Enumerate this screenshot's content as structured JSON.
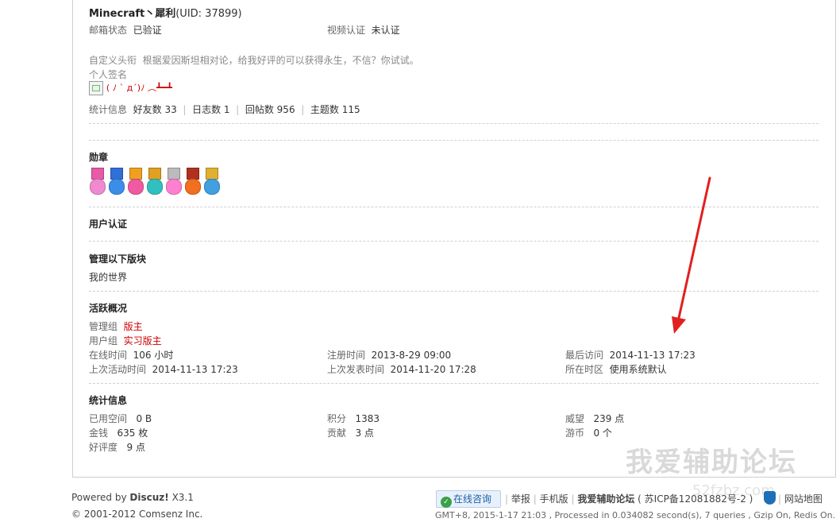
{
  "profile": {
    "username": "Minecraft丶犀利",
    "uid": "(UID: 37899)",
    "email_status_label": "邮箱状态",
    "email_status_value": "已验证",
    "video_auth_label": "视频认证",
    "video_auth_value": "未认证",
    "custom_title_label": "自定义头衔",
    "custom_title_value": "根据爱因斯坦相对论，给我好评的可以获得永生，不信？你试试。",
    "signature_label": "个人签名",
    "signature_text": "( ﾉ ` д´)ﾉ ︵┻━┻"
  },
  "stats": {
    "label": "统计信息",
    "friends": "好友数 33",
    "blogs": "日志数 1",
    "replies": "回帖数 956",
    "threads": "主题数 115",
    "separator": "|"
  },
  "medals": {
    "heading": "勋章",
    "items": [
      {
        "icon": "pink-flower-medal-icon",
        "ribbon": "#e85aa8",
        "badge": "#f08ad0"
      },
      {
        "icon": "blue-shield-medal-icon",
        "ribbon": "#2f6fd6",
        "badge": "#3a8ee8"
      },
      {
        "icon": "orange-heart-medal-icon",
        "ribbon": "#f0a020",
        "badge": "#f05aa0"
      },
      {
        "icon": "teal-heart-medal-icon",
        "ribbon": "#e0a020",
        "badge": "#30c0c0"
      },
      {
        "icon": "pink-heart-necklace-icon",
        "ribbon": "#bbbbbb",
        "badge": "#ff80d0"
      },
      {
        "icon": "fire-medal-icon",
        "ribbon": "#b03020",
        "badge": "#f07020"
      },
      {
        "icon": "blue-gear-medal-icon",
        "ribbon": "#e0b030",
        "badge": "#40a0e0"
      }
    ]
  },
  "user_auth": {
    "heading": "用户认证"
  },
  "moderated": {
    "heading": "管理以下版块",
    "forum": "我的世界"
  },
  "activity": {
    "heading": "活跃概况",
    "admin_group_label": "管理组",
    "admin_group_value": "版主",
    "user_group_label": "用户组",
    "user_group_value": "实习版主",
    "online_time_label": "在线时间",
    "online_time_value": "106 小时",
    "register_time_label": "注册时间",
    "register_time_value": "2013-8-29 09:00",
    "last_visit_label": "最后访问",
    "last_visit_value": "2014-11-13 17:23",
    "last_active_label": "上次活动时间",
    "last_active_value": "2014-11-13 17:23",
    "last_post_label": "上次发表时间",
    "last_post_value": "2014-11-20 17:28",
    "timezone_label": "所在时区",
    "timezone_value": "使用系统默认"
  },
  "statistics": {
    "heading": "统计信息",
    "space_label": "已用空间",
    "space_value": "0 B",
    "points_label": "积分",
    "points_value": "1383",
    "prestige_label": "威望",
    "prestige_value": "239 点",
    "money_label": "金钱",
    "money_value": "635 枚",
    "contribution_label": "贡献",
    "contribution_value": "3 点",
    "coins_label": "游币",
    "coins_value": "0 个",
    "rating_label": "好评度",
    "rating_value": "9 点"
  },
  "footer": {
    "powered_prefix": "Powered by",
    "powered_brand": "Discuz!",
    "powered_version": "X3.1",
    "copyright": "© 2001-2012 Comsenz Inc.",
    "online_consult": "在线咨询",
    "report": "举报",
    "mobile": "手机版",
    "site_name": "我爱辅助论坛",
    "icp": "( 苏ICP备12081882号-2 )",
    "sitemap": "网站地图",
    "sep": "|",
    "debug": "GMT+8, 2015-1-17 21:03 , Processed in 0.034082 second(s), 7 queries , Gzip On, Redis On."
  },
  "watermark": {
    "text": "我爱辅助论坛",
    "url": "52fzbz.com"
  },
  "colors": {
    "accent_red": "#cc0000",
    "arrow_red": "#e02020",
    "divider": "#d0d0d0"
  }
}
